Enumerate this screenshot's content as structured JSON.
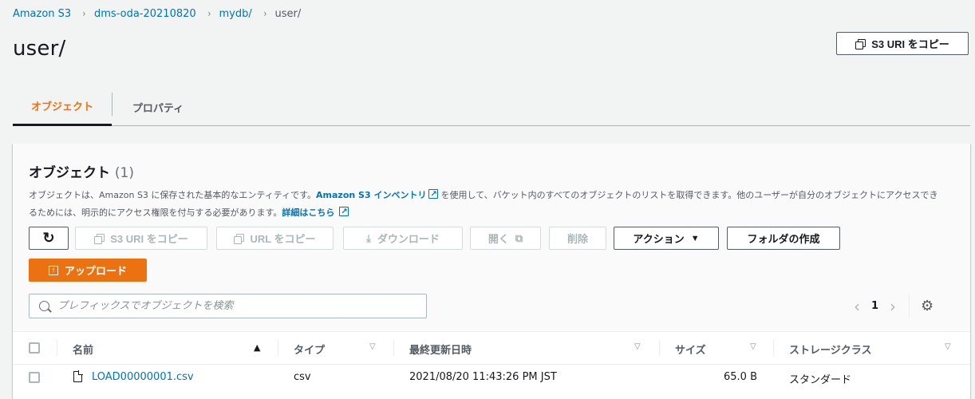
{
  "breadcrumb": {
    "items": [
      "Amazon S3",
      "dms-oda-20210820",
      "mydb/"
    ],
    "current": "user/",
    "separator": "›"
  },
  "page": {
    "title": "user/",
    "copy_uri_label": "S3 URI をコピー"
  },
  "tabs": [
    {
      "label": "オブジェクト",
      "active": true
    },
    {
      "label": "プロパティ",
      "active": false
    }
  ],
  "panel": {
    "title": "オブジェクト",
    "count": "(1)",
    "desc_part1": "オブジェクトは、Amazon S3 に保存された基本的なエンティティです。",
    "desc_link1": "Amazon S3 インベントリ",
    "desc_part2": "を使用して、バケット内のすべてのオブジェクトのリストを取得できます。他のユーザーが自分のオブジェクトにアクセスできるためには、明示的にアクセス権限を付与する必要があります。",
    "desc_link2": "詳細はこちら"
  },
  "toolbar": {
    "copy_s3_uri": "S3 URI をコピー",
    "copy_url": "URL をコピー",
    "download": "ダウンロード",
    "open": "開く",
    "delete": "削除",
    "actions": "アクション",
    "create_folder": "フォルダの作成",
    "upload": "アップロード"
  },
  "search": {
    "placeholder": "プレフィックスでオブジェクトを検索"
  },
  "pagination": {
    "current_page": "1"
  },
  "table": {
    "columns": [
      "名前",
      "タイプ",
      "最終更新日時",
      "サイズ",
      "ストレージクラス"
    ],
    "rows": [
      {
        "name": "LOAD00000001.csv",
        "type": "csv",
        "modified": "2021/08/20 11:43:26 PM JST",
        "size": "65.0 B",
        "storage_class": "スタンダード"
      }
    ]
  },
  "colors": {
    "accent_orange": "#ec7211",
    "link_blue": "#0073bb",
    "background": "#f2f3f3"
  },
  "icons": [
    "chevron-right-icon",
    "copy-icon",
    "refresh-icon",
    "download-icon",
    "external-link-icon",
    "caret-down-icon",
    "upload-icon",
    "search-icon",
    "chevron-left-icon",
    "gear-icon",
    "file-icon",
    "sort-asc-icon",
    "sort-desc-icon"
  ]
}
